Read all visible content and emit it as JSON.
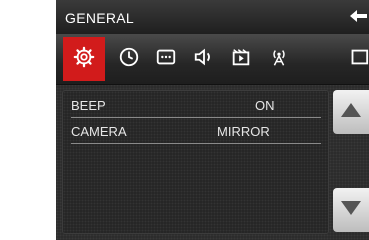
{
  "header": {
    "title": "GENERAL"
  },
  "tabs": [
    {
      "icon": "gear-icon",
      "active": true
    },
    {
      "icon": "clock-icon",
      "active": false
    },
    {
      "icon": "display-icon",
      "active": false
    },
    {
      "icon": "speaker-icon",
      "active": false
    },
    {
      "icon": "video-icon",
      "active": false
    },
    {
      "icon": "antenna-icon",
      "active": false
    }
  ],
  "settings": [
    {
      "label": "BEEP",
      "value": "ON"
    },
    {
      "label": "CAMERA",
      "value": "MIRROR"
    }
  ],
  "colors": {
    "accent": "#d21b1b",
    "background": "#2a2a2a",
    "text": "#ffffff"
  }
}
